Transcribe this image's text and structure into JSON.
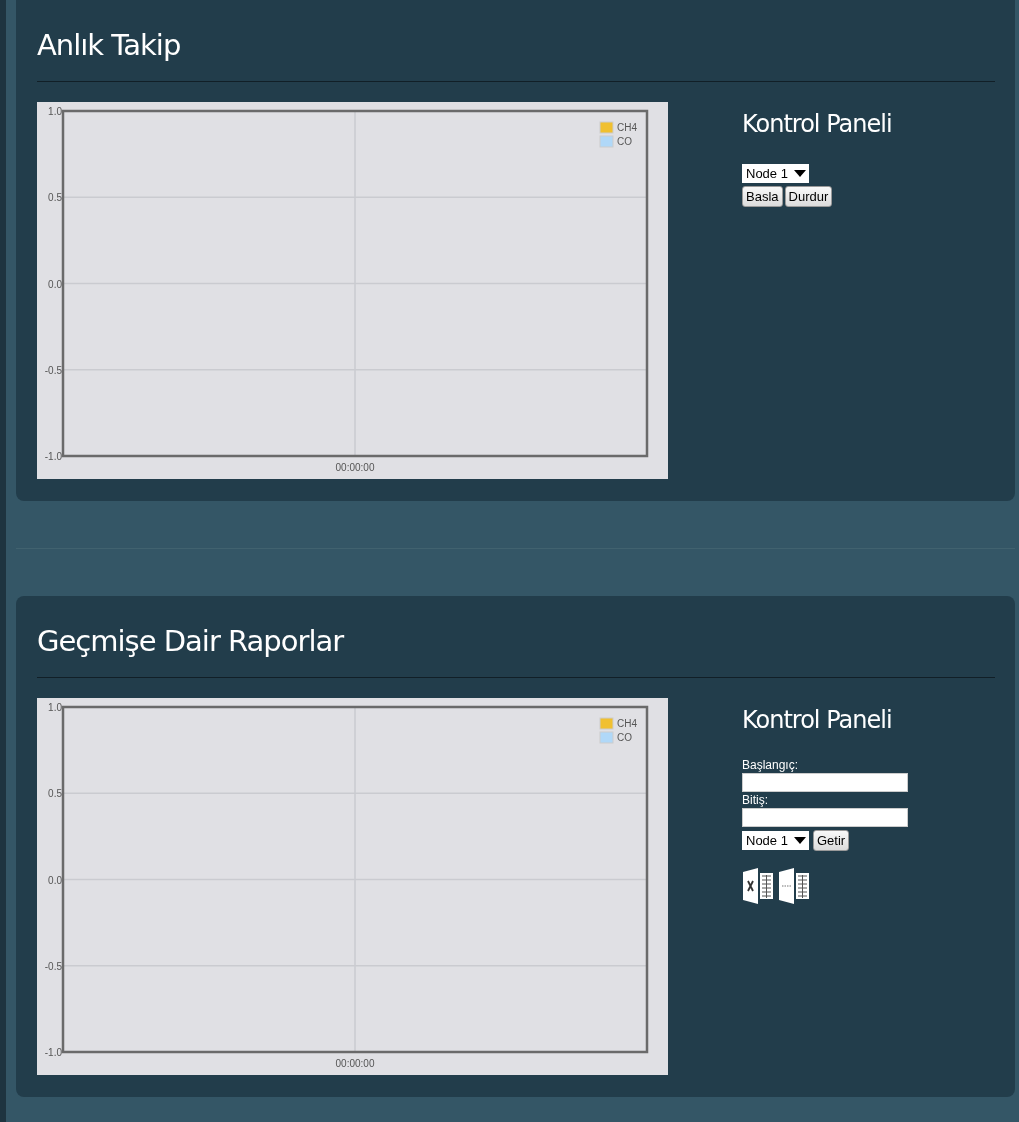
{
  "sections": [
    {
      "title": "Anlık Takip",
      "kind": "live",
      "chart_data": {
        "type": "line",
        "grid": true,
        "categories": [
          "00:00:00"
        ],
        "ylim": [
          -1,
          1
        ],
        "yticks": [
          {
            "value": 1,
            "label": "1.0"
          },
          {
            "value": 0.5,
            "label": "0.5"
          },
          {
            "value": 0,
            "label": "0.0"
          },
          {
            "value": -0.5,
            "label": "-0.5"
          },
          {
            "value": -1,
            "label": "-1.0"
          }
        ],
        "series": [
          {
            "name": "CH4",
            "color": "#f0c030",
            "values": [
              null
            ]
          },
          {
            "name": "CO",
            "color": "#b0d8f8",
            "values": [
              null
            ]
          }
        ]
      },
      "panel": {
        "title": "Kontrol Paneli",
        "node": "Node 1",
        "buttons": [
          "Basla",
          "Durdur"
        ]
      }
    },
    {
      "title": "Geçmişe Dair Raporlar",
      "kind": "report",
      "chart_data": {
        "type": "line",
        "grid": true,
        "categories": [
          "00:00:00"
        ],
        "ylim": [
          -1,
          1
        ],
        "yticks": [
          {
            "value": 1,
            "label": "1.0"
          },
          {
            "value": 0.5,
            "label": "0.5"
          },
          {
            "value": 0,
            "label": "0.0"
          },
          {
            "value": -0.5,
            "label": "-0.5"
          },
          {
            "value": -1,
            "label": "-1.0"
          }
        ],
        "series": [
          {
            "name": "CH4",
            "color": "#f0c030",
            "values": [
              null
            ]
          },
          {
            "name": "CO",
            "color": "#b0d8f8",
            "values": [
              null
            ]
          }
        ]
      },
      "panel": {
        "title": "Kontrol Paneli",
        "start_label": "Başlangıç:",
        "end_label": "Bitiş:",
        "node": "Node 1",
        "buttons": [
          "Getir"
        ],
        "export_icons": [
          {
            "kind": "spreadsheet"
          },
          {
            "kind": "json"
          }
        ]
      }
    }
  ]
}
